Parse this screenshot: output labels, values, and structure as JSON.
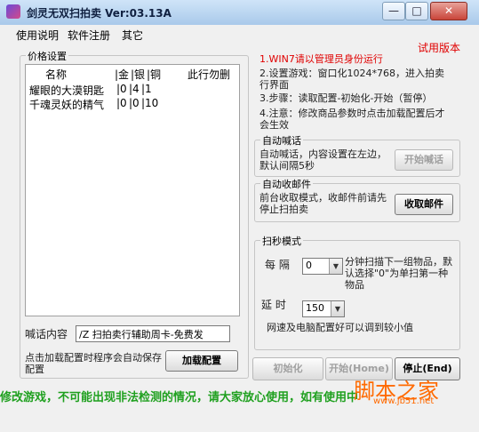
{
  "window": {
    "title": "剑灵无双扫拍卖  Ver:03.13A",
    "buttons": {
      "minimize": "—",
      "maximize": "□",
      "close": "✕"
    }
  },
  "menu": [
    "使用说明",
    "软件注册",
    "其它"
  ],
  "price_settings": {
    "group_label": "价格设置",
    "columns": [
      "名称",
      "|金",
      "|银",
      "|铜",
      "此行勿删"
    ],
    "rows": [
      {
        "name": "耀眼的大漠钥匙",
        "gold": "|0",
        "silver": "|4",
        "copper": "|1"
      },
      {
        "name": "千魂灵妖的精气",
        "gold": "|0",
        "silver": "|0",
        "copper": "|10"
      }
    ]
  },
  "chat": {
    "label": "喊话内容",
    "value": "/Z 扫拍卖行辅助周卡-免费发",
    "load_hint": "点击加载配置时程序会自动保存配置",
    "load_button": "加载配置"
  },
  "trial_badge": "试用版本",
  "instructions": [
    "1.WIN7请以管理员身份运行",
    "2.设置游戏：窗口化1024*768，进入拍卖行界面",
    "3.步骤：读取配置-初始化-开始（暂停）",
    "4.注意：修改商品参数时点击加载配置后才会生效"
  ],
  "auto_chat": {
    "group_label": "自动喊话",
    "desc": "自动喊话，内容设置在左边，默认间隔5秒",
    "button": "开始喊话"
  },
  "auto_mail": {
    "group_label": "自动收邮件",
    "desc": "前台收取模式，收邮件前请先停止扫拍卖",
    "button": "收取邮件"
  },
  "scan_mode": {
    "group_label": "扫秒模式",
    "interval_label": "每 隔",
    "interval_value": "0",
    "interval_desc": "分钟扫描下一组物品，默认选择\"0\"为单扫第一种物品",
    "delay_label": "延 时",
    "delay_value": "150",
    "delay_desc": "网速及电脑配置好可以调到较小值"
  },
  "controls": {
    "init": "初始化",
    "start": "开始(Home)",
    "stop": "停止(End)"
  },
  "marquee": "修改游戏，不可能出现非法检测的情况，请大家放心使用，如有使用中",
  "watermark": {
    "logo": "脚本之家",
    "url": "www.jb51.net"
  }
}
